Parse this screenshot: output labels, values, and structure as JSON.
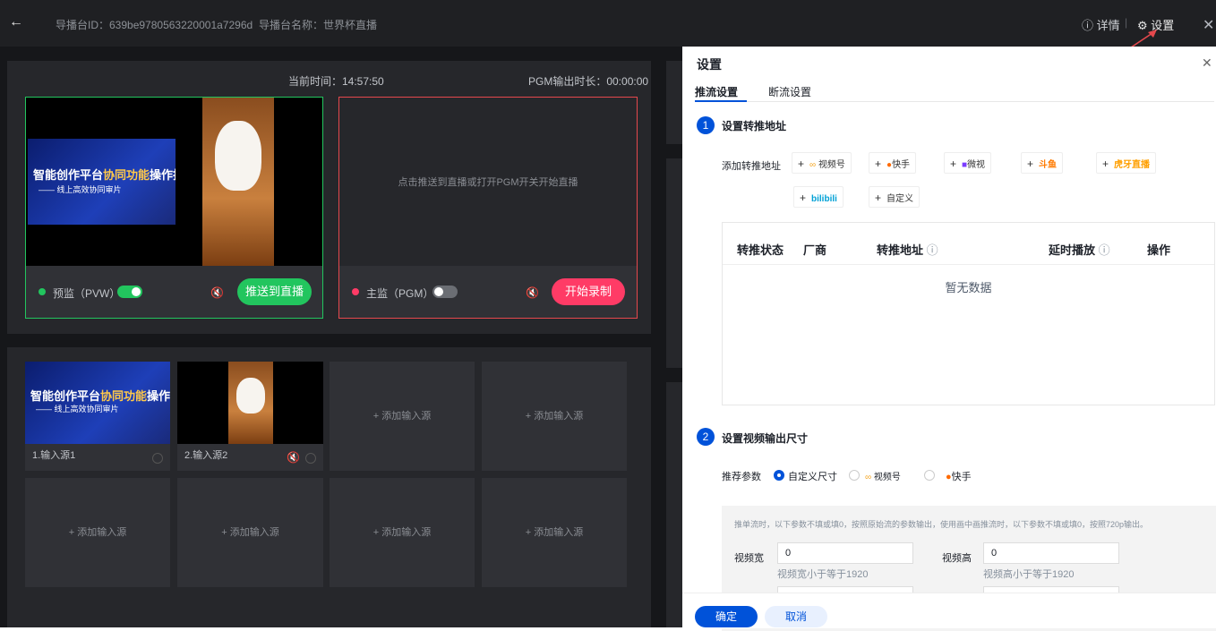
{
  "header": {
    "back_icon": "arrow-left-icon",
    "director_id": "导播台ID：639be9780563220001a7296d",
    "director_name": "导播台名称：世界杯直播",
    "detail_label": "详情",
    "separator": "|",
    "settings_label": "设置",
    "close_icon": "close-icon"
  },
  "stage": {
    "current_time": "当前时间：14:57:50",
    "pgm_duration": "PGM输出时长：00:00:00",
    "pgm_placeholder": "点击推送到直播或打开PGM开关开始直播",
    "pvw_label": "预监（PVW）",
    "pvw_on": true,
    "pgm_label": "主监（PGM）",
    "pgm_on": false,
    "push_button": "推送到直播",
    "record_button": "开始录制",
    "accent_green": "#22c55e",
    "accent_red": "#ff3b66"
  },
  "poster": {
    "title_prefix": "智能创作平台",
    "title_highlight": "协同功能",
    "title_suffix": "操作指南",
    "subtitle": "—— 线上高效协同审片"
  },
  "sources": {
    "items": [
      {
        "label": "1.输入源1"
      },
      {
        "label": "2.输入源2"
      }
    ],
    "add_label": "+ 添加输入源"
  },
  "settings": {
    "title": "设置",
    "close_icon": "close-icon",
    "tabs": [
      "推流设置",
      "断流设置"
    ],
    "step1": {
      "num": "1",
      "title": "设置转推地址"
    },
    "add_relay_label": "添加转推地址",
    "platforms": [
      "视频号",
      "快手",
      "微视",
      "斗鱼",
      "虎牙直播",
      "bilibili",
      "自定义"
    ],
    "table": {
      "headers": [
        "转推状态",
        "厂商",
        "转推地址",
        "延时播放",
        "操作"
      ],
      "empty": "暂无数据"
    },
    "step2": {
      "num": "2",
      "title": "设置视频输出尺寸"
    },
    "recommend_label": "推荐参数",
    "recommend_options": [
      "自定义尺寸",
      "视频号",
      "快手"
    ],
    "hint": "推单流时，以下参数不填或填0，按照原始流的参数输出，使用画中画推流时，以下参数不填或填0，按照720p输出。",
    "width_label": "视频宽",
    "width_value": "0",
    "width_tip": "视频宽小于等于1920",
    "height_label": "视频高",
    "height_value": "0",
    "height_tip": "视频高小于等于1920",
    "confirm": "确定",
    "cancel": "取消",
    "primary_color": "#0052d9"
  }
}
